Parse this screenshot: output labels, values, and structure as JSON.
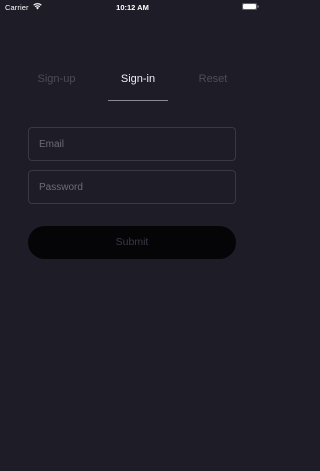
{
  "status_bar": {
    "carrier": "Carrier",
    "time": "10:12 AM"
  },
  "tabs": [
    {
      "label": "Sign-up",
      "active": false
    },
    {
      "label": "Sign-in",
      "active": true
    },
    {
      "label": "Reset",
      "active": false
    }
  ],
  "form": {
    "email": {
      "placeholder": "Email",
      "value": ""
    },
    "password": {
      "placeholder": "Password",
      "value": ""
    },
    "submit_label": "Submit"
  },
  "colors": {
    "background": "#1e1c26",
    "active_tab": "#eeeef2",
    "inactive_tab": "#4e4c58",
    "button_bg": "#050407"
  },
  "icons": [
    "wifi-icon",
    "battery-icon"
  ]
}
